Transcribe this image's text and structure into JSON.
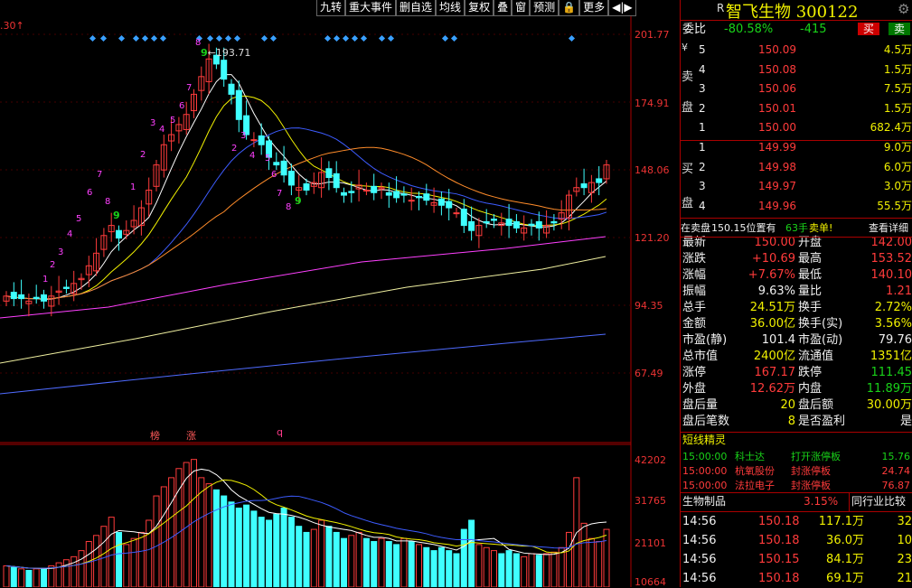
{
  "toolbar": {
    "items": [
      "九转",
      "重大事件",
      "删自选",
      "均线",
      "复权",
      "叠",
      "窗",
      "预测",
      "🔒",
      "更多",
      "◀|▶"
    ],
    "top_left_label": ".30",
    "top_left_arrow": "↑"
  },
  "price_axis": [
    "201.77",
    "174.91",
    "148.06",
    "121.20",
    "94.35",
    "67.49"
  ],
  "volume_axis": [
    "42202",
    "31765",
    "21101",
    "10664"
  ],
  "peak_label": "193.71",
  "peak_marker": "9",
  "bottom_markers": {
    "bang": "榜",
    "zhang": "涨",
    "q": "q"
  },
  "colors": {
    "bg": "#000000",
    "up": "#ff3b3b",
    "down": "#3fffff",
    "grid": "#a00000",
    "ma5": "#ffffff",
    "ma10": "#f0f000",
    "ma20": "#ff40ff",
    "ma30": "#3d5cff",
    "ma60": "#ff8c2a",
    "ma120": "#f0f0a0",
    "ma250": "#4f6bff"
  },
  "stock": {
    "r_label": "R",
    "name": "智飞生物",
    "code": "300122",
    "settings_icon": "gear-icon"
  },
  "wei": {
    "label": "委比",
    "ratio": "-80.58%",
    "diff": "-415",
    "buy_btn": "买",
    "sell_btn": "卖"
  },
  "sell_side_label": [
    "卖",
    "盘"
  ],
  "sell_book": [
    {
      "level": "5",
      "price": "150.09",
      "vol": "4.5万"
    },
    {
      "level": "4",
      "price": "150.08",
      "vol": "1.5万"
    },
    {
      "level": "3",
      "price": "150.06",
      "vol": "7.5万"
    },
    {
      "level": "2",
      "price": "150.01",
      "vol": "1.5万"
    },
    {
      "level": "1",
      "price": "150.00",
      "vol": "682.4万"
    }
  ],
  "buy_side_label": [
    "买",
    "盘"
  ],
  "buy_book": [
    {
      "level": "1",
      "price": "149.99",
      "vol": "9.0万"
    },
    {
      "level": "2",
      "price": "149.98",
      "vol": "6.0万"
    },
    {
      "level": "3",
      "price": "149.97",
      "vol": "3.0万"
    },
    {
      "level": "4",
      "price": "149.96",
      "vol": "55.5万"
    }
  ],
  "position_note": {
    "prefix": "在卖盘",
    "value": "150.15位置有",
    "hands": "63手",
    "sell": "卖单!",
    "detail": "查看详细"
  },
  "quote": [
    {
      "l": "最新",
      "lv": "150.00",
      "r": "开盘",
      "rv": "142.00",
      "lc": "red",
      "rc": "red"
    },
    {
      "l": "涨跌",
      "lv": "+10.69",
      "r": "最高",
      "rv": "153.52",
      "lc": "red",
      "rc": "red"
    },
    {
      "l": "涨幅",
      "lv": "+7.67%",
      "r": "最低",
      "rv": "140.10",
      "lc": "red",
      "rc": "red"
    },
    {
      "l": "振幅",
      "lv": "9.63%",
      "r": "量比",
      "rv": "1.21",
      "lc": "white",
      "rc": "red"
    },
    {
      "l": "总手",
      "lv": "24.51万",
      "r": "换手",
      "rv": "2.72%",
      "lc": "yellow",
      "rc": "yellow"
    },
    {
      "l": "金额",
      "lv": "36.00亿",
      "r": "换手(实)",
      "rv": "3.56%",
      "lc": "yellow",
      "rc": "yellow"
    },
    {
      "l": "市盈(静)",
      "lv": "101.4",
      "r": "市盈(动)",
      "rv": "79.76",
      "lc": "white",
      "rc": "white"
    },
    {
      "l": "总市值",
      "lv": "2400亿",
      "r": "流通值",
      "rv": "1351亿",
      "lc": "yellow",
      "rc": "yellow"
    },
    {
      "l": "涨停",
      "lv": "167.17",
      "r": "跌停",
      "rv": "111.45",
      "lc": "red",
      "rc": "green"
    },
    {
      "l": "外盘",
      "lv": "12.62万",
      "r": "内盘",
      "rv": "11.89万",
      "lc": "red",
      "rc": "green"
    },
    {
      "l": "盘后量",
      "lv": "20",
      "r": "盘后额",
      "rv": "30.00万",
      "lc": "yellow",
      "rc": "yellow"
    },
    {
      "l": "盘后笔数",
      "lv": "8",
      "r": "是否盈利",
      "rv": "是",
      "lc": "yellow",
      "rc": "white"
    }
  ],
  "sprite": {
    "title": "短线精灵",
    "items": [
      {
        "time": "15:00:00",
        "name": "科士达",
        "event": "打开涨停板",
        "val": "15.76",
        "color": "green"
      },
      {
        "time": "15:00:00",
        "name": "杭氧股份",
        "event": "封涨停板",
        "val": "24.74",
        "color": "red"
      },
      {
        "time": "15:00:00",
        "name": "法拉电子",
        "event": "封涨停板",
        "val": "76.87",
        "color": "red"
      }
    ]
  },
  "sector": {
    "name": "生物制品",
    "pct": "3.15%",
    "compare": "同行业比较"
  },
  "ticks": [
    {
      "t": "14:56",
      "p": "150.18",
      "v": "117.1万",
      "n": "32"
    },
    {
      "t": "14:56",
      "p": "150.18",
      "v": "36.0万",
      "n": "10"
    },
    {
      "t": "14:56",
      "p": "150.15",
      "v": "84.1万",
      "n": "23"
    },
    {
      "t": "14:56",
      "p": "150.18",
      "v": "69.1万",
      "n": "21"
    }
  ]
}
